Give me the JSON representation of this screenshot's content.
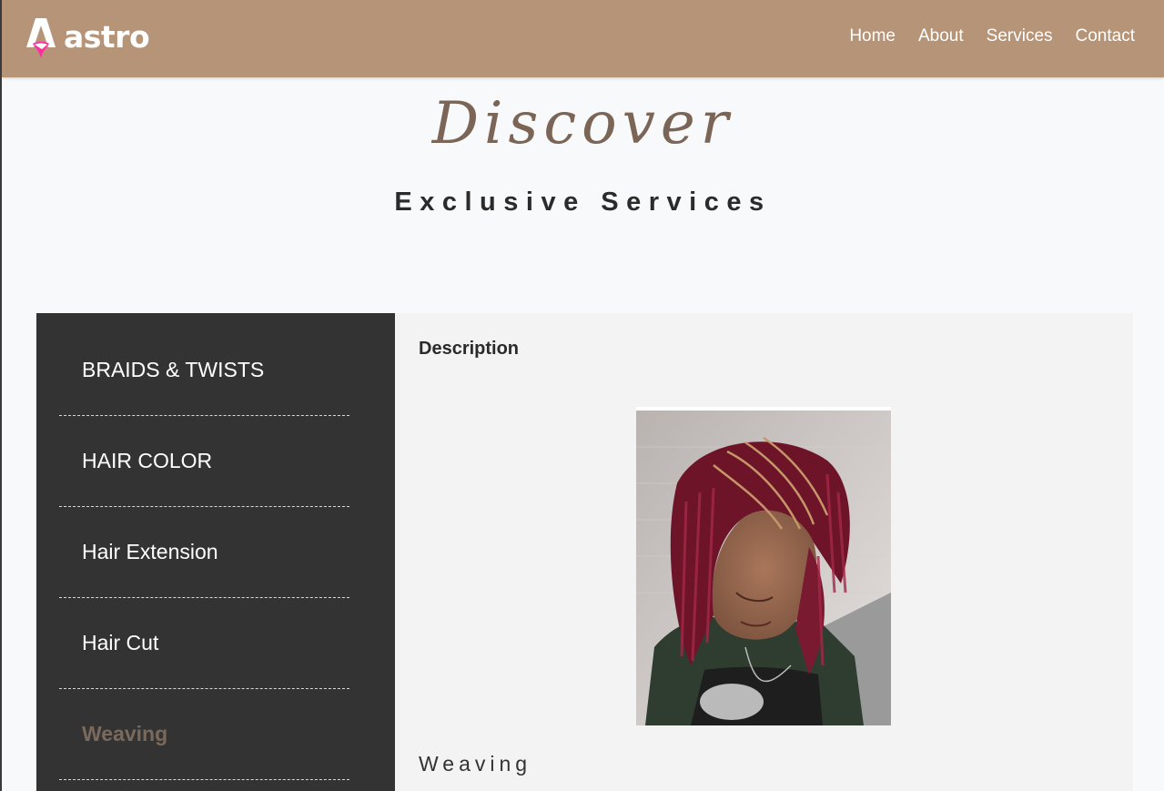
{
  "header": {
    "logo_text": "astro",
    "brand_color": "#b69478",
    "nav": [
      {
        "label": "Home"
      },
      {
        "label": "About"
      },
      {
        "label": "Services"
      },
      {
        "label": "Contact"
      }
    ]
  },
  "hero": {
    "script_title": "Discover",
    "title": "Exclusive Services"
  },
  "services": {
    "tabs": [
      {
        "label": "BRAIDS & TWISTS",
        "active": false
      },
      {
        "label": "HAIR COLOR",
        "active": false
      },
      {
        "label": "Hair Extension",
        "active": false
      },
      {
        "label": "Hair Cut",
        "active": false
      },
      {
        "label": "Weaving",
        "active": true
      }
    ],
    "content": {
      "heading": "Description",
      "service_name": "Weaving",
      "image_icon": "braided-hair-photo"
    }
  }
}
